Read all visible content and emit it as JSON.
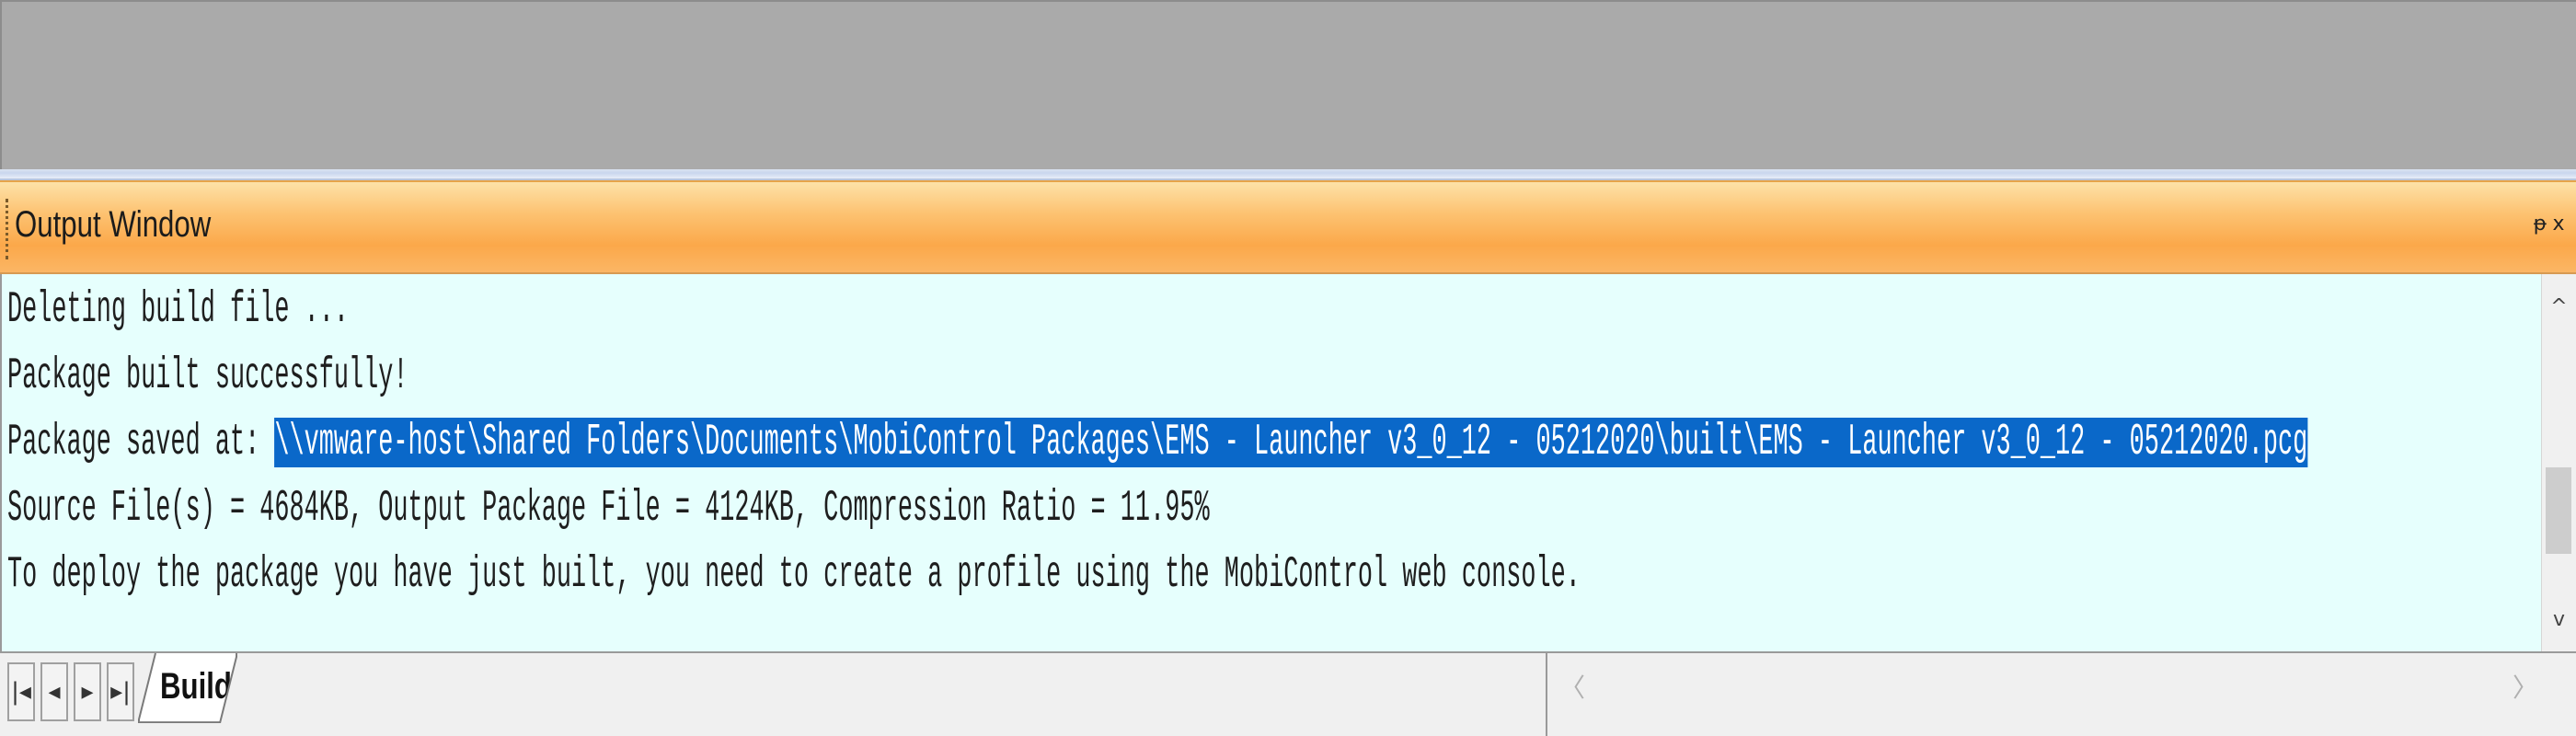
{
  "output_window": {
    "title": "Output Window",
    "pin_label": "ᵽ",
    "close_label": "x",
    "lines": [
      "Deleting build file ...",
      "Package built successfully!",
      "Source File(s) = 4684KB, Output Package File = 4124KB, Compression Ratio = 11.95%",
      "To deploy the package you have just built, you need to create a profile using the MobiControl web console."
    ],
    "saved_prefix": "Package saved at: ",
    "saved_path": "\\\\vmware-host\\Shared Folders\\Documents\\MobiControl Packages\\EMS - Launcher v3_0_12 - 05212020\\built\\EMS - Launcher v3_0_12 - 05212020.pcg",
    "selection_color": "#0a68c9",
    "background_color": "#e6fffd"
  },
  "scrollbar": {
    "up_icon": "^",
    "down_icon": "v"
  },
  "tabs": {
    "nav_first": "|◂",
    "nav_prev": "◂",
    "nav_next": "▸",
    "nav_last": "▸|",
    "build_label": "Build"
  },
  "hscroll": {
    "left_icon": "〈",
    "right_icon": "〉"
  },
  "colors": {
    "title_gradient_top": "#fde2a8",
    "title_gradient_mid": "#fba84a"
  }
}
